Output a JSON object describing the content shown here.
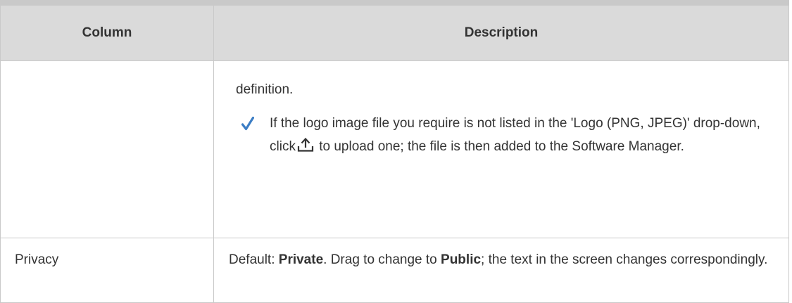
{
  "table": {
    "headers": [
      "Column",
      "Description"
    ],
    "row1": {
      "column": "",
      "definition_text": "definition.",
      "tip": {
        "icon": "checkmark-icon",
        "text_before_icon": "If the logo image file you require is not listed in the 'Logo (PNG, JPEG)' drop-down, click",
        "inline_icon": "upload-icon",
        "text_after_icon": "to upload one; the file is then added to the Software Manager."
      }
    },
    "row2": {
      "column": "Privacy",
      "desc_part1": "Default: ",
      "desc_bold1": "Private",
      "desc_part2": ". Drag to change to ",
      "desc_bold2": "Public",
      "desc_part3": "; the text in the screen changes correspondingly."
    }
  },
  "colors": {
    "header_bg": "#dadada",
    "border": "#c9c9c9",
    "text": "#333333",
    "check": "#3b7dc4"
  }
}
